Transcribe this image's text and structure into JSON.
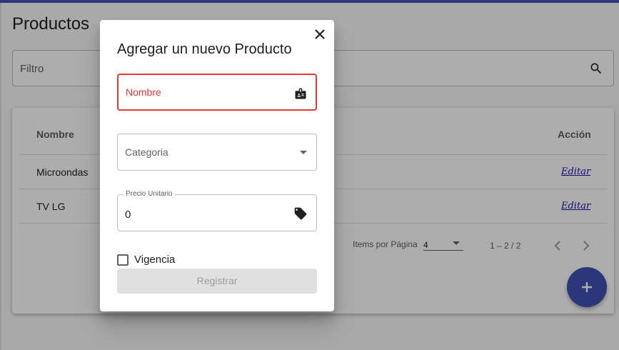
{
  "page": {
    "title": "Productos",
    "filter_label": "Filtro",
    "accent_color": "#3f51b5"
  },
  "table": {
    "headers": {
      "name": "Nombre",
      "action": "Acción"
    },
    "rows": [
      {
        "name": "Microondas",
        "action": "Editar"
      },
      {
        "name": "TV LG",
        "action": "Editar"
      }
    ]
  },
  "paginator": {
    "items_per_page_label": "Items por Página",
    "page_size": "4",
    "range": "1 – 2 / 2"
  },
  "dialog": {
    "title": "Agregar un nuevo Producto",
    "name_field": {
      "label": "Nombre",
      "icon": "id-badge-icon",
      "state_color": "#e53935"
    },
    "category_field": {
      "label": "Categoria",
      "icon": "dropdown-arrow-icon"
    },
    "price_field": {
      "label": "Precio Unitario",
      "value": "0",
      "icon": "tag-icon"
    },
    "validity_checkbox": {
      "label": "Vigencia",
      "checked": false
    },
    "submit_label": "Registrar"
  }
}
